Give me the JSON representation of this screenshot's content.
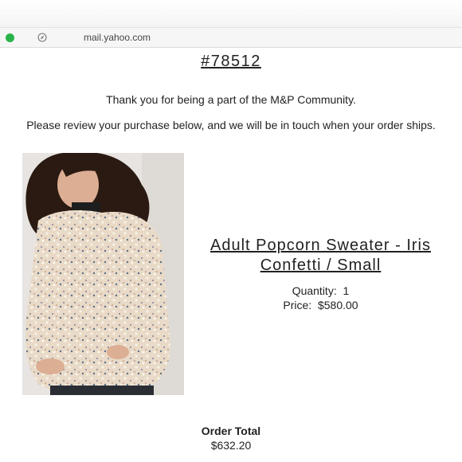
{
  "browser": {
    "url": "mail.yahoo.com",
    "status_dot_color": "#2ab34a",
    "nav_icon": "compass-icon"
  },
  "email": {
    "order_number": "#78512",
    "thank_you": "Thank you for being a part of the M&P Community.",
    "review_message": "Please review your purchase below, and we will be in touch when your order ships."
  },
  "item": {
    "name": "Adult Popcorn Sweater - Iris Confetti / Small",
    "quantity_label": "Quantity:",
    "quantity": "1",
    "price_label": "Price:",
    "price": "$580.00"
  },
  "summary": {
    "total_label": "Order Total",
    "total_value": "$632.20"
  }
}
